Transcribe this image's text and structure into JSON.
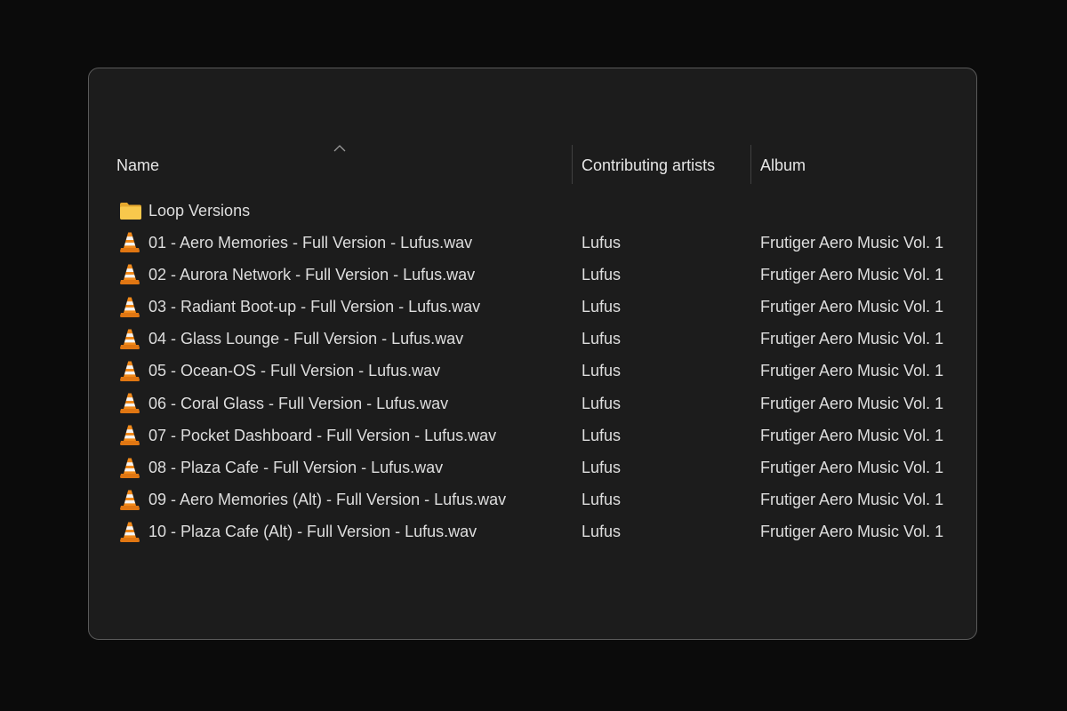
{
  "columns": {
    "name": "Name",
    "artist": "Contributing artists",
    "album": "Album"
  },
  "sort": {
    "column": "name",
    "direction": "ascending",
    "indicator": "^"
  },
  "colors": {
    "background": "#0b0b0b",
    "window": "#1c1c1c",
    "text": "#dedede",
    "folder": "#f6c34a",
    "vlc_orange": "#f28a1a"
  },
  "rows": [
    {
      "type": "folder",
      "icon": "folder-icon",
      "name": "Loop Versions",
      "artist": "",
      "album": ""
    },
    {
      "type": "file",
      "icon": "vlc-cone-icon",
      "name": "01 - Aero Memories - Full Version - Lufus.wav",
      "artist": "Lufus",
      "album": "Frutiger Aero Music Vol. 1"
    },
    {
      "type": "file",
      "icon": "vlc-cone-icon",
      "name": "02 - Aurora Network - Full Version - Lufus.wav",
      "artist": "Lufus",
      "album": "Frutiger Aero Music Vol. 1"
    },
    {
      "type": "file",
      "icon": "vlc-cone-icon",
      "name": "03 - Radiant Boot-up - Full Version - Lufus.wav",
      "artist": "Lufus",
      "album": "Frutiger Aero Music Vol. 1"
    },
    {
      "type": "file",
      "icon": "vlc-cone-icon",
      "name": "04 - Glass Lounge - Full Version - Lufus.wav",
      "artist": "Lufus",
      "album": "Frutiger Aero Music Vol. 1"
    },
    {
      "type": "file",
      "icon": "vlc-cone-icon",
      "name": "05 - Ocean-OS - Full Version - Lufus.wav",
      "artist": "Lufus",
      "album": "Frutiger Aero Music Vol. 1"
    },
    {
      "type": "file",
      "icon": "vlc-cone-icon",
      "name": "06 - Coral Glass - Full Version - Lufus.wav",
      "artist": "Lufus",
      "album": "Frutiger Aero Music Vol. 1"
    },
    {
      "type": "file",
      "icon": "vlc-cone-icon",
      "name": "07 - Pocket Dashboard - Full Version - Lufus.wav",
      "artist": "Lufus",
      "album": "Frutiger Aero Music Vol. 1"
    },
    {
      "type": "file",
      "icon": "vlc-cone-icon",
      "name": "08 - Plaza Cafe - Full Version - Lufus.wav",
      "artist": "Lufus",
      "album": "Frutiger Aero Music Vol. 1"
    },
    {
      "type": "file",
      "icon": "vlc-cone-icon",
      "name": "09 - Aero Memories (Alt) - Full Version - Lufus.wav",
      "artist": "Lufus",
      "album": "Frutiger Aero Music Vol. 1"
    },
    {
      "type": "file",
      "icon": "vlc-cone-icon",
      "name": "10 - Plaza Cafe (Alt) - Full Version - Lufus.wav",
      "artist": "Lufus",
      "album": "Frutiger Aero Music Vol. 1"
    }
  ]
}
